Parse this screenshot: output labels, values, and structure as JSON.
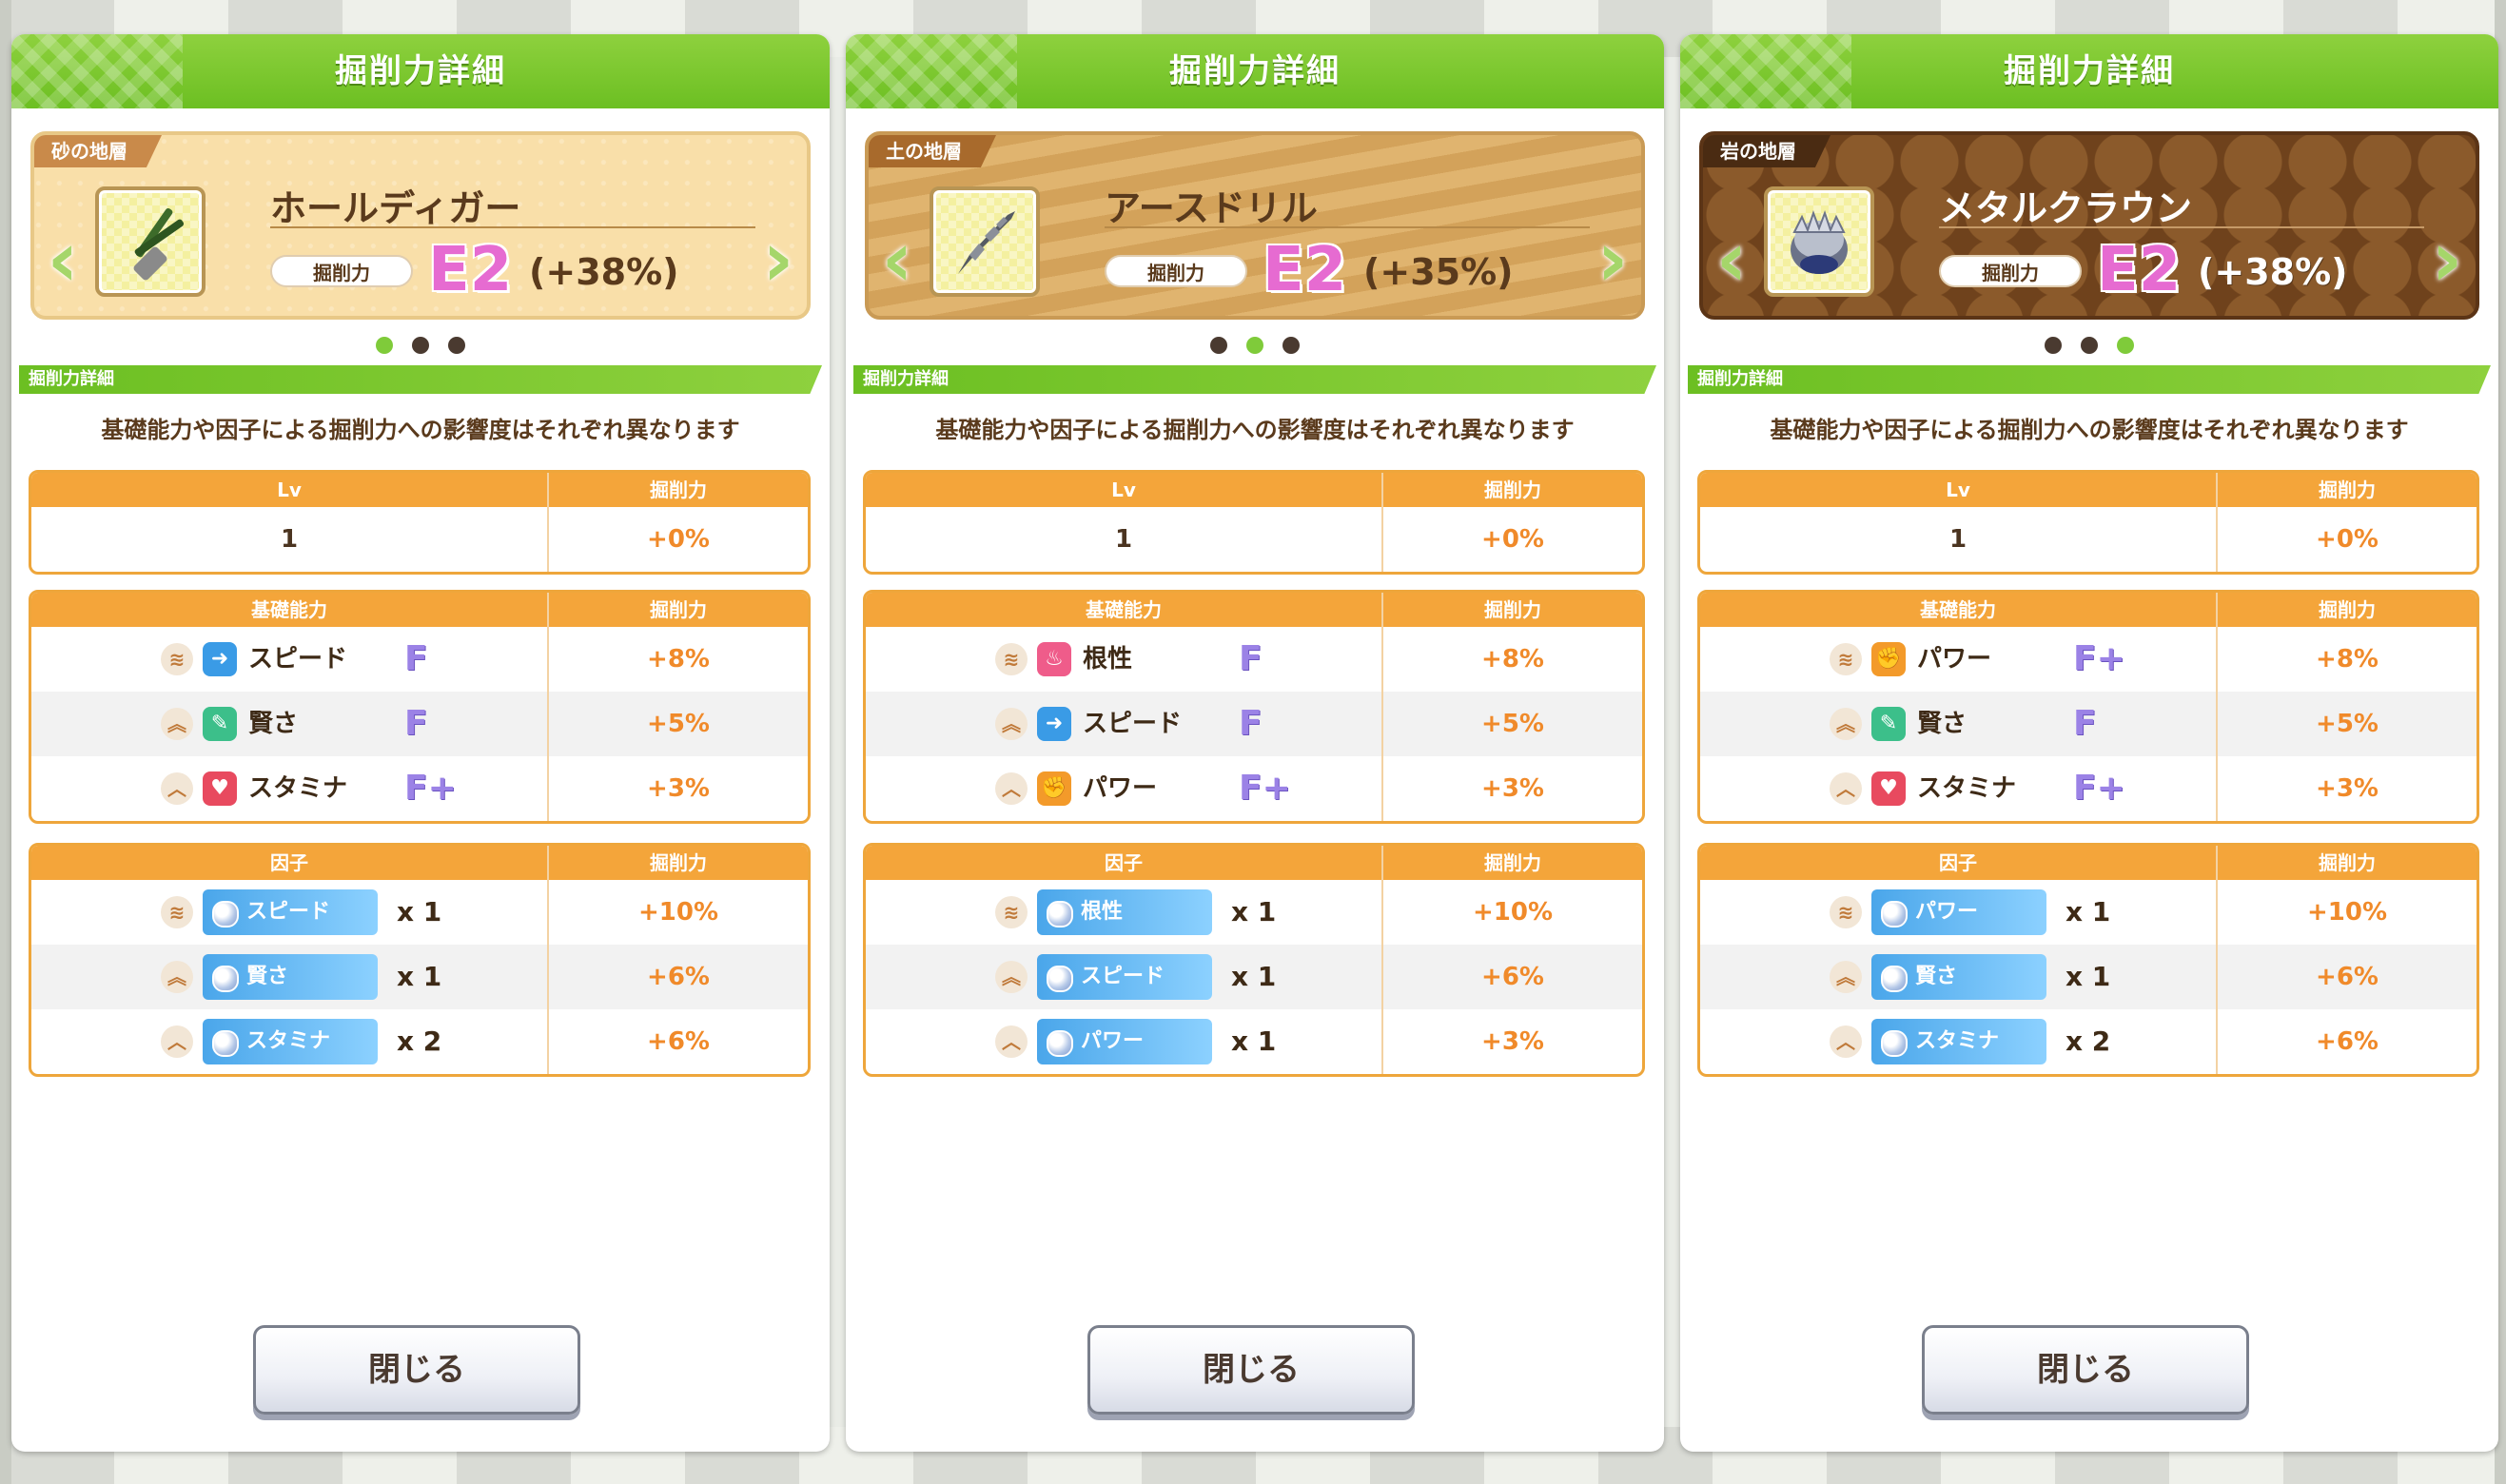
{
  "panels": [
    {
      "title": "掘削力詳細",
      "layer": "砂の地層",
      "tool_name": "ホールディガー",
      "power_label": "掘削力",
      "rank": "E2",
      "rank_pct": "(+38%)",
      "active_dot": 0,
      "section_title": "掘削力詳細",
      "description": "基礎能力や因子による掘削力への影響度はそれぞれ異なります",
      "lv_table": {
        "headers": [
          "Lv",
          "掘削力"
        ],
        "rows": [
          [
            "1",
            "+0%"
          ]
        ]
      },
      "base_table": {
        "headers": [
          "基礎能力",
          "掘削力"
        ],
        "rows": [
          {
            "level": 3,
            "stat": "スピード",
            "grade": "F",
            "value": "+8%"
          },
          {
            "level": 2,
            "stat": "賢さ",
            "grade": "F",
            "value": "+5%"
          },
          {
            "level": 1,
            "stat": "スタミナ",
            "grade": "F+",
            "value": "+3%"
          }
        ]
      },
      "factor_table": {
        "headers": [
          "因子",
          "掘削力"
        ],
        "rows": [
          {
            "level": 3,
            "factor": "スピード",
            "count": "x 1",
            "value": "+10%"
          },
          {
            "level": 2,
            "factor": "賢さ",
            "count": "x 1",
            "value": "+6%"
          },
          {
            "level": 1,
            "factor": "スタミナ",
            "count": "x 2",
            "value": "+6%"
          }
        ]
      },
      "close_label": "閉じる"
    },
    {
      "title": "掘削力詳細",
      "layer": "土の地層",
      "tool_name": "アースドリル",
      "power_label": "掘削力",
      "rank": "E2",
      "rank_pct": "(+35%)",
      "active_dot": 1,
      "section_title": "掘削力詳細",
      "description": "基礎能力や因子による掘削力への影響度はそれぞれ異なります",
      "lv_table": {
        "headers": [
          "Lv",
          "掘削力"
        ],
        "rows": [
          [
            "1",
            "+0%"
          ]
        ]
      },
      "base_table": {
        "headers": [
          "基礎能力",
          "掘削力"
        ],
        "rows": [
          {
            "level": 3,
            "stat": "根性",
            "grade": "F",
            "value": "+8%"
          },
          {
            "level": 2,
            "stat": "スピード",
            "grade": "F",
            "value": "+5%"
          },
          {
            "level": 1,
            "stat": "パワー",
            "grade": "F+",
            "value": "+3%"
          }
        ]
      },
      "factor_table": {
        "headers": [
          "因子",
          "掘削力"
        ],
        "rows": [
          {
            "level": 3,
            "factor": "根性",
            "count": "x 1",
            "value": "+10%"
          },
          {
            "level": 2,
            "factor": "スピード",
            "count": "x 1",
            "value": "+6%"
          },
          {
            "level": 1,
            "factor": "パワー",
            "count": "x 1",
            "value": "+3%"
          }
        ]
      },
      "close_label": "閉じる"
    },
    {
      "title": "掘削力詳細",
      "layer": "岩の地層",
      "tool_name": "メタルクラウン",
      "power_label": "掘削力",
      "rank": "E2",
      "rank_pct": "(+38%)",
      "active_dot": 2,
      "section_title": "掘削力詳細",
      "description": "基礎能力や因子による掘削力への影響度はそれぞれ異なります",
      "lv_table": {
        "headers": [
          "Lv",
          "掘削力"
        ],
        "rows": [
          [
            "1",
            "+0%"
          ]
        ]
      },
      "base_table": {
        "headers": [
          "基礎能力",
          "掘削力"
        ],
        "rows": [
          {
            "level": 3,
            "stat": "パワー",
            "grade": "F+",
            "value": "+8%"
          },
          {
            "level": 2,
            "stat": "賢さ",
            "grade": "F",
            "value": "+5%"
          },
          {
            "level": 1,
            "stat": "スタミナ",
            "grade": "F+",
            "value": "+3%"
          }
        ]
      },
      "factor_table": {
        "headers": [
          "因子",
          "掘削力"
        ],
        "rows": [
          {
            "level": 3,
            "factor": "パワー",
            "count": "x 1",
            "value": "+10%"
          },
          {
            "level": 2,
            "factor": "賢さ",
            "count": "x 1",
            "value": "+6%"
          },
          {
            "level": 1,
            "factor": "スタミナ",
            "count": "x 2",
            "value": "+6%"
          }
        ]
      },
      "close_label": "閉じる"
    }
  ],
  "colors": {
    "header_green": "#6cbf22",
    "table_orange": "#f4a53a",
    "value_orange": "#f08a2a",
    "grade_purple": "#9b82e6",
    "rank_pink": "#e66bd1"
  },
  "icons": {
    "stat_icons": {
      "スピード": "shoe-icon",
      "賢さ": "graduation-cap-icon",
      "スタミナ": "heart-icon",
      "根性": "fire-icon",
      "パワー": "muscle-icon"
    }
  }
}
